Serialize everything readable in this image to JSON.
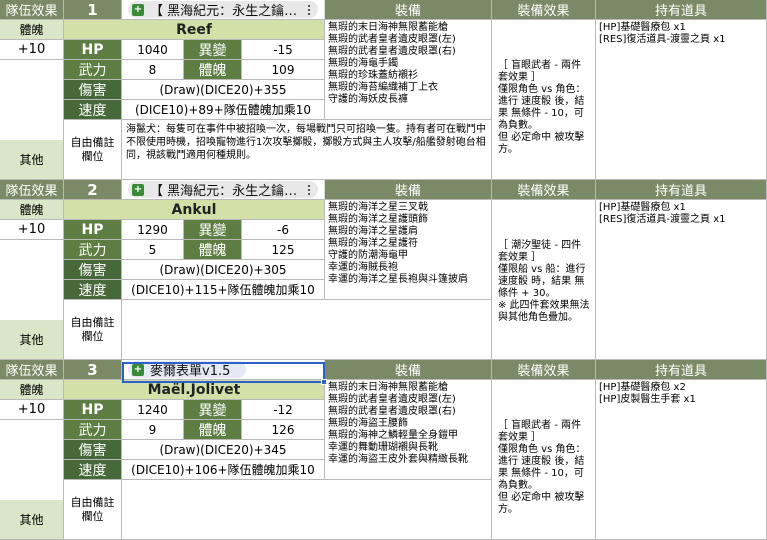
{
  "headers": {
    "team_effect": "隊伍效果",
    "equipment": "裝備",
    "equip_effect": "裝備效果",
    "held_items": "持有道具"
  },
  "left_labels": {
    "body_soul": "體魄",
    "other": "其他"
  },
  "stat_labels": {
    "hp": "HP",
    "power": "武力",
    "damage": "傷害",
    "speed": "速度",
    "mutation": "異變",
    "body": "體魄"
  },
  "note_label": "自由備註欄位",
  "rows": [
    {
      "number": "1",
      "sheet_tab": "【 黑海紀元：永生之鑰…",
      "body_soul_value": "+10",
      "name": "Reef",
      "hp": "1040",
      "mutation": "-15",
      "power": "8",
      "body": "109",
      "damage": "(Draw)(DICE20)+355",
      "speed": "(DICE10)+89+隊伍體魄加乘10",
      "equipment": [
        "無瑕的末日海神無限蓄能槍",
        "無瑕的武者皇者遺皮眼罩(左)",
        "無瑕的武者皇者遺皮眼罩(右)",
        "無瑕的海龜手鐲",
        "無瑕的珍珠蓋紡襯衫",
        "無瑕的海苔編織補丁上衣",
        "守護的海妖皮長褲"
      ],
      "equip_effect": "［ 盲眼武者 - 兩件套效果 ］\n僅限角色 vs 角色：進行 速度骰 後，結果 無條件 - 10，可為負數。\n但 必定命中 被攻擊方。",
      "held_items": [
        "[HP]基礎醫療包 x1",
        "[RES]復活道具-渡靈之頁 x1"
      ],
      "note": "海鬣犬：每隻可在事件中被招喚一次，每場戰鬥只可招喚一隻。持有者可在戰鬥中不限使用時機，招喚寵物進行1次攻擊擲骰，擲骰方式與主人攻擊/船艦發射砲台相同，視該戰鬥適用何種規則。"
    },
    {
      "number": "2",
      "sheet_tab": "【 黑海紀元：永生之鑰…",
      "body_soul_value": "+10",
      "name": "Ankul",
      "hp": "1290",
      "mutation": "-6",
      "power": "5",
      "body": "125",
      "damage": "(Draw)(DICE20)+305",
      "speed": "(DICE10)+115+隊伍體魄加乘10",
      "equipment": [
        "無瑕的海洋之星三叉戟",
        "無瑕的海洋之星護頭飾",
        "無瑕的海洋之星護肩",
        "無瑕的海洋之星護符",
        "守護的防潮海龜甲",
        "幸運的海賊長袍",
        "幸運的海洋之星長袍與斗篷披肩"
      ],
      "equip_effect": "［ 潮汐聖徒 - 四件套效果 ］\n僅限船 vs 船：進行 速度骰 時，結果 無條件 + 30。\n※ 此四件套效果無法與其他角色疊加。",
      "held_items": [
        "[HP]基礎醫療包 x1",
        "[RES]復活道具-渡靈之頁 x1"
      ],
      "note": ""
    },
    {
      "number": "3",
      "sheet_tab": "麥爾表單v1.5",
      "body_soul_value": "+10",
      "name": "Maël.Jolivet",
      "hp": "1240",
      "mutation": "-12",
      "power": "9",
      "body": "126",
      "damage": "(Draw)(DICE20)+345",
      "speed": "(DICE10)+106+隊伍體魄加乘10",
      "equipment": [
        "無瑕的末日海神無限蓄能槍",
        "無瑕的武者皇者遺皮眼罩(左)",
        "無瑕的武者皇者遺皮眼罩(右)",
        "無瑕的海盜王腰飾",
        "無瑕的海神之鱗輕量全身鎧甲",
        "幸運的舞動珊瑚襯與長靴",
        "幸運的海盜王皮外套與精緻長靴"
      ],
      "equip_effect": "［ 盲眼武者 - 兩件套效果 ］\n僅限角色 vs 角色：進行 速度骰 後，結果 無條件 - 10，可為負數。\n但 必定命中 被攻擊方。",
      "held_items": [
        "[HP]基礎醫療包 x2",
        "[HP]皮製醫生手套 x1"
      ],
      "note": ""
    }
  ]
}
